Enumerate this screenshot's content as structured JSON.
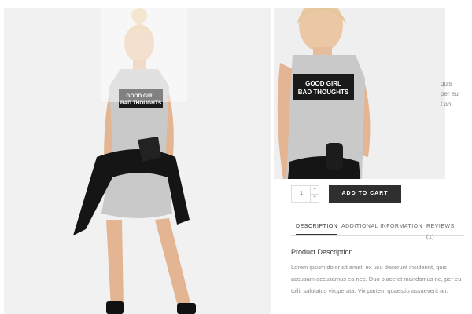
{
  "product": {
    "shirt_print": [
      "GOOD GIRL",
      "BAD THOUGHTS"
    ]
  },
  "background_text": {
    "lines": [
      "quis",
      "per eu",
      "t an."
    ]
  },
  "cart": {
    "quantity": "1",
    "increment_symbol": "+",
    "decrement_symbol": "−",
    "add_to_cart_label": "ADD TO CART"
  },
  "tabs": [
    {
      "label": "DESCRIPTION",
      "active": true
    },
    {
      "label": "ADDITIONAL INFORMATION",
      "active": false
    },
    {
      "label": "REVIEWS (1)",
      "active": false
    }
  ],
  "description": {
    "title": "Product Description",
    "body": "Lorem ipsum dolor sit amet, ex usu deserunt inciderint, quis accusam accusamus ea nec. Duo placerat mandamus ne, per eu tollit salutatus vituperata. Vix partem quaestio assueverit an."
  },
  "colors": {
    "button_bg": "#2f2f2f",
    "photo_bg": "#f1f1f1",
    "dress": "#c9c9c9",
    "print_band": "#1a1a1a"
  },
  "icons": {
    "increment": "plus-icon",
    "decrement": "minus-icon"
  }
}
